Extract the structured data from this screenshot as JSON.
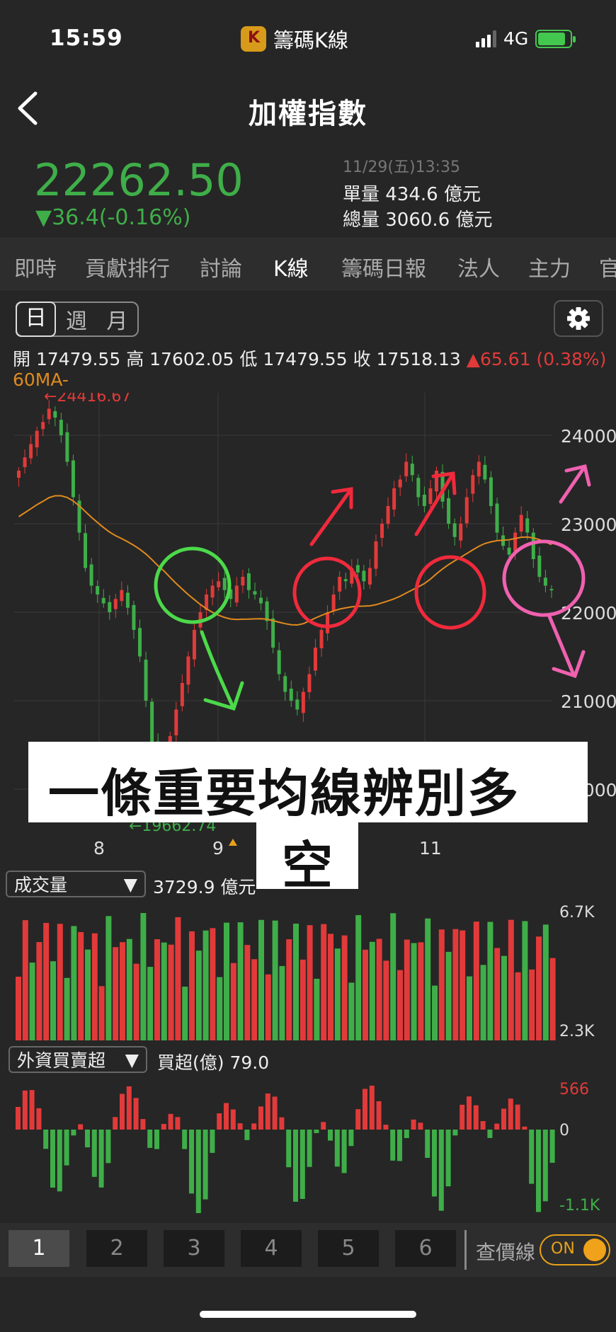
{
  "status_bar": {
    "time": "15:59",
    "app_name": "籌碼K線",
    "network": "4G"
  },
  "header": {
    "title": "加權指數"
  },
  "quote": {
    "price": "22262.50",
    "change": "▼36.4(-0.16%)",
    "datetime": "11/29(五)13:35",
    "single_volume": "單量 434.6 億元",
    "total_volume": "總量 3060.6 億元"
  },
  "tabs": [
    "即時",
    "貢獻排行",
    "討論",
    "K線",
    "籌碼日報",
    "法人",
    "主力",
    "官"
  ],
  "periods": [
    "日",
    "週",
    "月"
  ],
  "ohlc": {
    "open": "開 17479.55",
    "high": "高 17602.05",
    "low": "低 17479.55",
    "close": "收 17518.13",
    "change": "▲65.61 (0.38%)"
  },
  "ma_label": "60MA-",
  "annotations": {
    "high_mark": "←24416.67",
    "low_mark": "←19662.74"
  },
  "overlay_text": {
    "line1": "一條重要均線辨別多",
    "line2": "空"
  },
  "volume_panel": {
    "selector": "成交量",
    "value": "3729.9 億元",
    "axis_max": "6.7K",
    "axis_min": "2.3K"
  },
  "foreign_panel": {
    "selector": "外資買賣超",
    "value": "買超(億) 79.0",
    "axis_max": "566",
    "axis_zero": "0",
    "axis_min": "-1.1K"
  },
  "bottom_bar": {
    "tabs": [
      "1",
      "2",
      "3",
      "4",
      "5",
      "6"
    ],
    "price_line_label": "查價線",
    "toggle": "ON"
  },
  "colors": {
    "up": "#e23a3a",
    "down": "#3fae49",
    "ma": "#e08a1e",
    "accent": "#f0a21a"
  },
  "chart_data": {
    "type": "candlestick",
    "ylim": [
      19000,
      25000
    ],
    "y_ticks": [
      "24000",
      "23000",
      "22000",
      "21000",
      "20000"
    ],
    "x_ticks": [
      "8",
      "9",
      "11"
    ],
    "high": 24416.67,
    "low": 19662.74,
    "close_series": [
      23600,
      23750,
      23900,
      24050,
      24150,
      24300,
      24200,
      24000,
      23700,
      23300,
      22900,
      22500,
      22300,
      22200,
      22100,
      22000,
      22150,
      22250,
      22050,
      21800,
      21500,
      21000,
      20500,
      20000,
      20200,
      20600,
      20900,
      21200,
      21500,
      21800,
      22000,
      22200,
      22300,
      22350,
      22250,
      22150,
      22300,
      22400,
      22250,
      22200,
      22100,
      21900,
      21600,
      21300,
      21100,
      21000,
      20900,
      21100,
      21300,
      21600,
      21800,
      22000,
      22200,
      22400,
      22350,
      22500,
      22450,
      22350,
      22500,
      22800,
      23000,
      23200,
      23400,
      23500,
      23700,
      23550,
      23300,
      23200,
      23400,
      23600,
      23250,
      23000,
      22850,
      23000,
      23300,
      23550,
      23700,
      23500,
      23200,
      22900,
      22750,
      22650,
      22900,
      23100,
      22900,
      22600,
      22400,
      22300,
      22262
    ]
  }
}
